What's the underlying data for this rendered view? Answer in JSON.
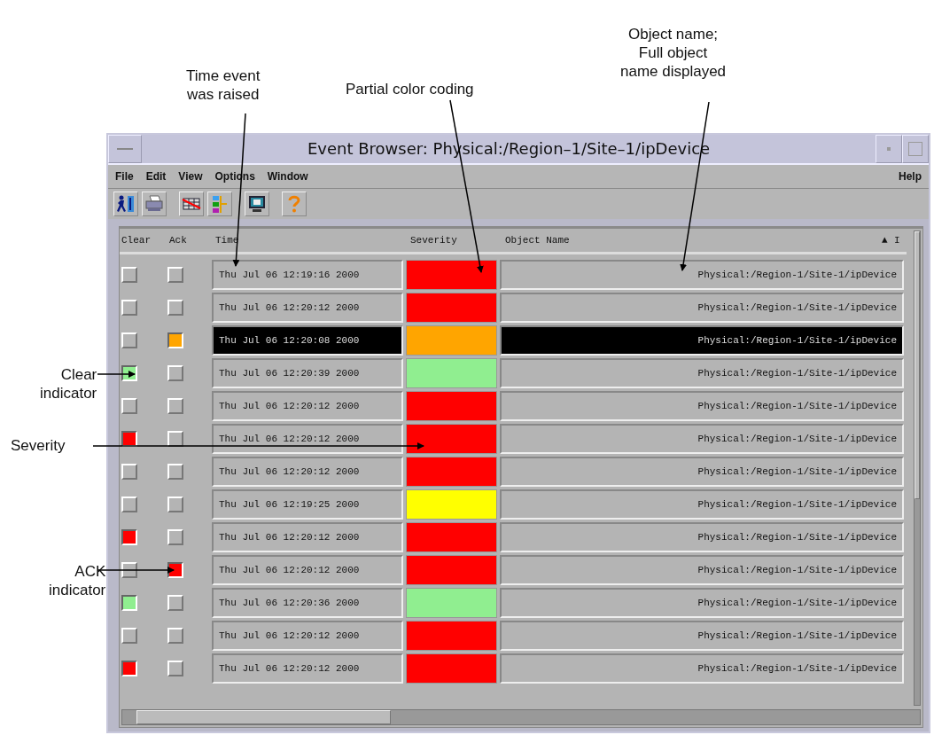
{
  "annotations": [
    {
      "kind": "top",
      "lines": [
        "Time event",
        "was raised"
      ]
    },
    {
      "kind": "top",
      "lines": [
        "Partial color coding"
      ]
    },
    {
      "kind": "top",
      "lines": [
        "Object name;",
        "Full object",
        "name displayed"
      ]
    },
    {
      "kind": "left",
      "lines": [
        "Clear",
        "indicator"
      ]
    },
    {
      "kind": "left",
      "lines": [
        "Severity"
      ]
    },
    {
      "kind": "left",
      "lines": [
        "ACK",
        "indicator"
      ]
    }
  ],
  "window": {
    "title": "Event Browser: Physical:/Region–1/Site–1/ipDevice"
  },
  "menu": {
    "items": [
      "File",
      "Edit",
      "View",
      "Options",
      "Window"
    ],
    "help": "Help"
  },
  "toolbar": [
    {
      "kind": "exit"
    },
    {
      "kind": "print"
    },
    {
      "kind": "table"
    },
    {
      "kind": "blocks"
    },
    {
      "kind": "monitor"
    },
    {
      "kind": "help"
    }
  ],
  "table": {
    "columns": [
      "Clear",
      "Ack",
      "Time",
      "Severity",
      "Object Name"
    ],
    "sort_indicator": "▲",
    "column_6": "I",
    "rows": [
      {
        "clear": {
          "set": false
        },
        "ack": {
          "set": false
        },
        "time": "Thu Jul 06 12:19:16 2000",
        "color": "#ff0000",
        "object": "Physical:/Region-1/Site-1/ipDevice",
        "selected": false
      },
      {
        "clear": {
          "set": false
        },
        "ack": {
          "set": false
        },
        "time": "Thu Jul 06 12:20:12 2000",
        "color": "#ff0000",
        "object": "Physical:/Region-1/Site-1/ipDevice",
        "selected": false
      },
      {
        "clear": {
          "set": false
        },
        "ack": {
          "set": true,
          "color": "#ffa500"
        },
        "time": "Thu Jul 06 12:20:08 2000",
        "color": "#ffa500",
        "object": "Physical:/Region-1/Site-1/ipDevice",
        "selected": true
      },
      {
        "clear": {
          "set": true,
          "color": "#90ee90"
        },
        "ack": {
          "set": false
        },
        "time": "Thu Jul 06 12:20:39 2000",
        "color": "#90ee90",
        "object": "Physical:/Region-1/Site-1/ipDevice",
        "selected": false
      },
      {
        "clear": {
          "set": false
        },
        "ack": {
          "set": false
        },
        "time": "Thu Jul 06 12:20:12 2000",
        "color": "#ff0000",
        "object": "Physical:/Region-1/Site-1/ipDevice",
        "selected": false
      },
      {
        "clear": {
          "set": true,
          "color": "#ff0000"
        },
        "ack": {
          "set": false
        },
        "time": "Thu Jul 06 12:20:12 2000",
        "color": "#ff0000",
        "object": "Physical:/Region-1/Site-1/ipDevice",
        "selected": false
      },
      {
        "clear": {
          "set": false
        },
        "ack": {
          "set": false
        },
        "time": "Thu Jul 06 12:20:12 2000",
        "color": "#ff0000",
        "object": "Physical:/Region-1/Site-1/ipDevice",
        "selected": false
      },
      {
        "clear": {
          "set": false
        },
        "ack": {
          "set": false
        },
        "time": "Thu Jul 06 12:19:25 2000",
        "color": "#ffff00",
        "object": "Physical:/Region-1/Site-1/ipDevice",
        "selected": false
      },
      {
        "clear": {
          "set": true,
          "color": "#ff0000"
        },
        "ack": {
          "set": false
        },
        "time": "Thu Jul 06 12:20:12 2000",
        "color": "#ff0000",
        "object": "Physical:/Region-1/Site-1/ipDevice",
        "selected": false
      },
      {
        "clear": {
          "set": false
        },
        "ack": {
          "set": true,
          "color": "#ff0000"
        },
        "time": "Thu Jul 06 12:20:12 2000",
        "color": "#ff0000",
        "object": "Physical:/Region-1/Site-1/ipDevice",
        "selected": false
      },
      {
        "clear": {
          "set": true,
          "color": "#90ee90"
        },
        "ack": {
          "set": false
        },
        "time": "Thu Jul 06 12:20:36 2000",
        "color": "#90ee90",
        "object": "Physical:/Region-1/Site-1/ipDevice",
        "selected": false
      },
      {
        "clear": {
          "set": false
        },
        "ack": {
          "set": false
        },
        "time": "Thu Jul 06 12:20:12 2000",
        "color": "#ff0000",
        "object": "Physical:/Region-1/Site-1/ipDevice",
        "selected": false
      },
      {
        "clear": {
          "set": true,
          "color": "#ff0000"
        },
        "ack": {
          "set": false
        },
        "time": "Thu Jul 06 12:20:12 2000",
        "color": "#ff0000",
        "object": "Physical:/Region-1/Site-1/ipDevice",
        "selected": false
      }
    ]
  }
}
